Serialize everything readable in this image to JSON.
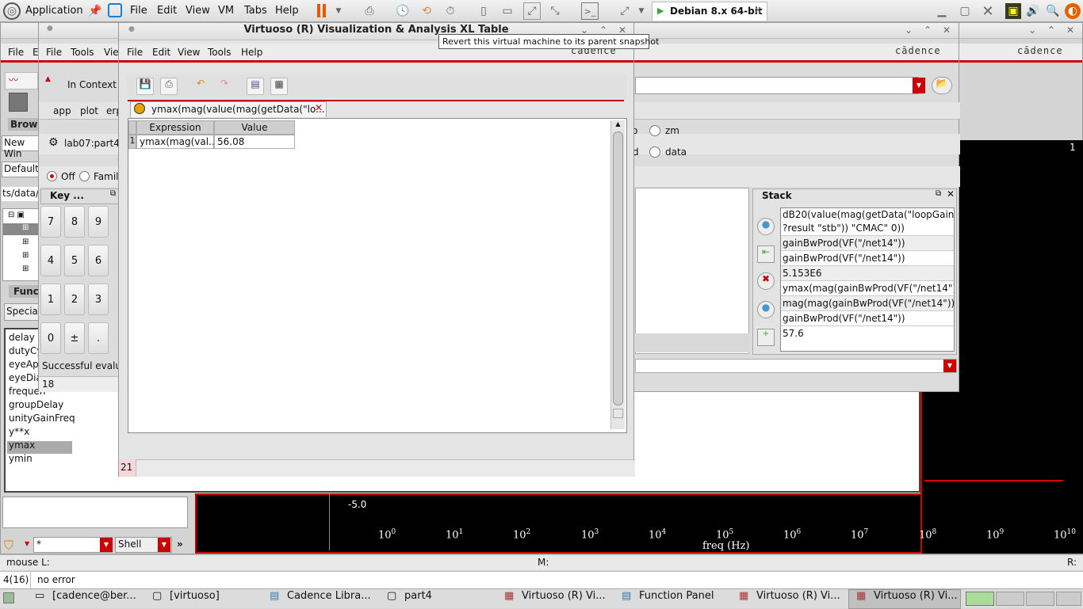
{
  "vmbar": {
    "applications": "Application",
    "menu": [
      "File",
      "Edit",
      "View",
      "VM",
      "Tabs",
      "Help"
    ],
    "vm_tab": "Debian 8.x 64-bit"
  },
  "tooltip": "Revert this virtual machine to its parent snapshot",
  "table_window": {
    "title": "Virtuoso (R) Visualization & Analysis XL Table",
    "menu": [
      "File",
      "Edit",
      "View",
      "Tools",
      "Help"
    ],
    "brand": "cādence",
    "tab": "ymax(mag(value(mag(getData(\"lo...",
    "columns": [
      "Expression",
      "Value"
    ],
    "rows": [
      {
        "index": "1",
        "expression": "ymax(mag(val...",
        "value": "56.08"
      }
    ],
    "status_num": "21"
  },
  "calc_window": {
    "menu": [
      "File",
      "Tools",
      "View"
    ],
    "brand": "cādence",
    "in_context": "In Context R",
    "toolbar2": [
      "app",
      "plot",
      "erp"
    ],
    "context_label": "lab07:part4:",
    "off": "Off",
    "family": "Family",
    "key_title": "Key ...",
    "keys": [
      "7",
      "8",
      "9",
      "4",
      "5",
      "6",
      "1",
      "2",
      "3",
      "0",
      "±",
      "."
    ],
    "status_msg": "Successful evalua",
    "status_num": "18",
    "radio_zm": "zm",
    "radio_d": "d",
    "radio_data": "data",
    "radio_o": "o",
    "stack_title": "Stack",
    "stack": [
      "dB20(value(mag(getData(\"loopGain\"",
      "?result \"stb\")) \"CMAC\" 0))",
      "gainBwProd(VF(\"/net14\"))",
      "gainBwProd(VF(\"/net14\"))",
      "5.153E6",
      "ymax(mag(gainBwProd(VF(\"/net14\")...",
      "mag(mag(gainBwProd(VF(\"/net14\"))))",
      "gainBwProd(VF(\"/net14\"))",
      "57.6"
    ]
  },
  "library_window": {
    "menu": [
      "File",
      "E"
    ],
    "brand": "cādence",
    "browse": "Brows",
    "new_win": "New Win",
    "default": "Default",
    "path": "ts/data/S",
    "func": "Func",
    "special": "Special",
    "functions": [
      "delay",
      "dutyCy",
      "eyeAp",
      "eyeDia",
      "frequen",
      "groupDelay",
      "unityGainFreq",
      "y**x",
      "ymax",
      "ymin"
    ],
    "filter": "*",
    "shell": "Shell"
  },
  "plot": {
    "y_label": "-5.0",
    "x_ticks": [
      {
        "b": "10",
        "e": "0"
      },
      {
        "b": "10",
        "e": "1"
      },
      {
        "b": "10",
        "e": "2"
      },
      {
        "b": "10",
        "e": "3"
      },
      {
        "b": "10",
        "e": "4"
      },
      {
        "b": "10",
        "e": "5"
      },
      {
        "b": "10",
        "e": "6"
      },
      {
        "b": "10",
        "e": "7"
      },
      {
        "b": "10",
        "e": "8"
      },
      {
        "b": "10",
        "e": "9"
      },
      {
        "b": "10",
        "e": "10"
      }
    ],
    "xlabel": "freq (Hz)",
    "corner": "1"
  },
  "statusbar": {
    "mouse": "mouse L:",
    "m": "M:",
    "r": "R:",
    "line_pos": "4(16)",
    "msg": "no error"
  },
  "taskbar": [
    "[cadence@ber...",
    "[virtuoso]",
    "Cadence Libra...",
    "part4",
    "Virtuoso (R) Vi...",
    "Function Panel",
    "Virtuoso (R) Vi...",
    "Virtuoso (R) Vi..."
  ]
}
